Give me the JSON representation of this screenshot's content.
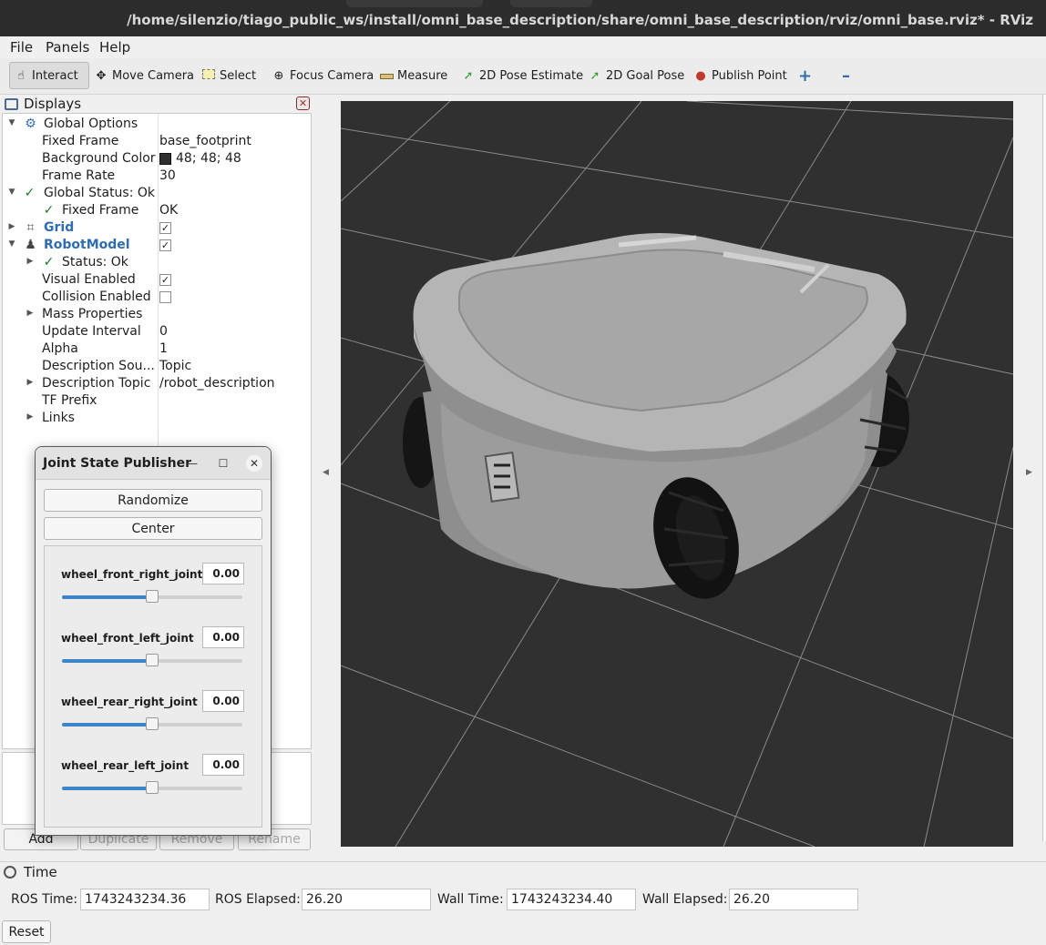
{
  "window": {
    "title": "/home/silenzio/tiago_public_ws/install/omni_base_description/share/omni_base_description/rviz/omni_base.rviz* - RViz"
  },
  "menu": [
    "File",
    "Panels",
    "Help"
  ],
  "toolbar": [
    {
      "label": "Interact",
      "icon": "interact-cursor-icon"
    },
    {
      "label": "Move Camera",
      "icon": "move-camera-icon"
    },
    {
      "label": "Select",
      "icon": "select-rectangle-icon"
    },
    {
      "label": "Focus Camera",
      "icon": "focus-camera-icon"
    },
    {
      "label": "Measure",
      "icon": "ruler-icon"
    },
    {
      "label": "2D Pose Estimate",
      "icon": "pose-arrow-icon"
    },
    {
      "label": "2D Goal Pose",
      "icon": "goal-arrow-icon"
    },
    {
      "label": "Publish Point",
      "icon": "map-pin-icon"
    }
  ],
  "displays": {
    "title": "Displays",
    "rows": [
      {
        "label": "Global Options",
        "value": ""
      },
      {
        "label": "Fixed Frame",
        "value": "base_footprint"
      },
      {
        "label": "Background Color",
        "value": "48; 48; 48"
      },
      {
        "label": "Frame Rate",
        "value": "30"
      },
      {
        "label": "Global Status: Ok",
        "value": ""
      },
      {
        "label": "Fixed Frame",
        "value": "OK"
      },
      {
        "label": "Grid",
        "value": ""
      },
      {
        "label": "RobotModel",
        "value": ""
      },
      {
        "label": "Status: Ok",
        "value": ""
      },
      {
        "label": "Visual Enabled",
        "value": ""
      },
      {
        "label": "Collision Enabled",
        "value": ""
      },
      {
        "label": "Mass Properties",
        "value": ""
      },
      {
        "label": "Update Interval",
        "value": "0"
      },
      {
        "label": "Alpha",
        "value": "1"
      },
      {
        "label": "Description Sou...",
        "value": "Topic"
      },
      {
        "label": "Description Topic",
        "value": "/robot_description"
      },
      {
        "label": "TF Prefix",
        "value": ""
      },
      {
        "label": "Links",
        "value": ""
      }
    ],
    "checks": {
      "grid": "✓",
      "robotmodel": "✓",
      "visual": "✓",
      "collision": ""
    },
    "buttons": [
      "Add",
      "Duplicate",
      "Remove",
      "Rename"
    ]
  },
  "background_color": "#303030",
  "joint_state_publisher": {
    "title": "Joint State Publisher",
    "randomize": "Randomize",
    "center": "Center",
    "joints": [
      {
        "name": "wheel_front_right_joint",
        "value": "0.00",
        "position": 0.5
      },
      {
        "name": "wheel_front_left_joint",
        "value": "0.00",
        "position": 0.5
      },
      {
        "name": "wheel_rear_right_joint",
        "value": "0.00",
        "position": 0.5
      },
      {
        "name": "wheel_rear_left_joint",
        "value": "0.00",
        "position": 0.5
      }
    ]
  },
  "time": {
    "title": "Time",
    "ros_time_label": "ROS Time:",
    "ros_time": "1743243234.36",
    "ros_elapsed_label": "ROS Elapsed:",
    "ros_elapsed": "26.20",
    "wall_time_label": "Wall Time:",
    "wall_time": "1743243234.40",
    "wall_elapsed_label": "Wall Elapsed:",
    "wall_elapsed": "26.20",
    "reset": "Reset"
  }
}
